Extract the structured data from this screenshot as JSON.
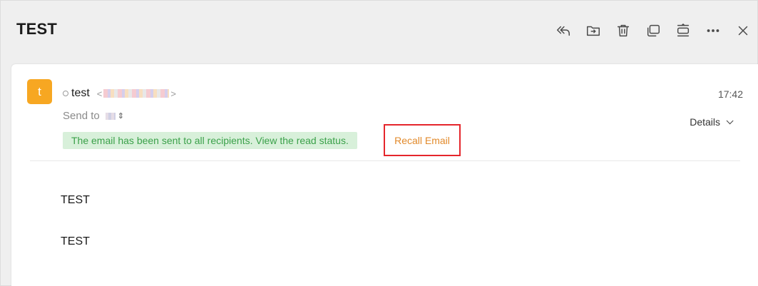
{
  "email": {
    "subject": "TEST",
    "sender": {
      "avatar_letter": "t",
      "name": "test",
      "email_open": "<",
      "email_close": ">"
    },
    "time": "17:42",
    "send_to_label": "Send to",
    "details_label": "Details",
    "sent_notice": "The email has been sent to all recipients. View the read status.",
    "recall_label": "Recall Email",
    "body_lines": [
      "TEST",
      "TEST"
    ]
  },
  "toolbar": {
    "icons": [
      "reply-all-icon",
      "move-to-folder-icon",
      "trash-icon",
      "new-window-icon",
      "expand-collapse-icon",
      "more-icon",
      "close-icon"
    ]
  },
  "colors": {
    "avatar": "#f7a722",
    "banner_bg": "#d8f0da",
    "banner_text": "#3ba14a",
    "recall_text": "#e28a2b",
    "highlight_border": "#e5262c"
  }
}
